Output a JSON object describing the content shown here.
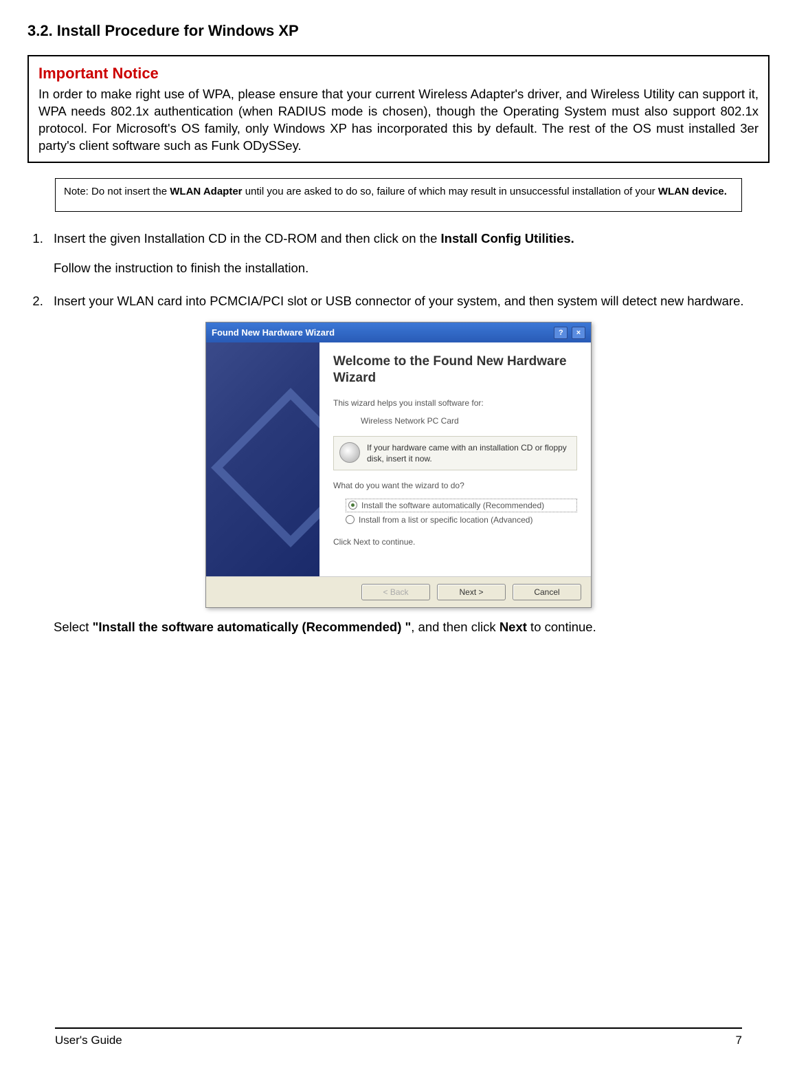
{
  "heading": "3.2. Install Procedure for Windows XP",
  "notice": {
    "title": "Important Notice",
    "body": "In order to make right use of WPA, please ensure that your current Wireless Adapter's driver, and Wireless Utility can support it, WPA needs 802.1x authentication (when RADIUS mode is chosen), though the Operating System must also support 802.1x protocol. For Microsoft's OS family, only Windows XP has incorporated this by default. The rest of the OS must installed 3er party's client software such as Funk ODySSey."
  },
  "note": {
    "pre": "Note: Do not insert the ",
    "bold1": "WLAN Adapter",
    "mid": " until you are asked to do so, failure of which may result in unsuccessful installation of your  ",
    "bold2": "WLAN device."
  },
  "step1": {
    "pre": "Insert the given Installation CD in the CD-ROM and then click on the ",
    "bold": "Install Config Utilities.",
    "sub": "Follow the instruction to finish the installation."
  },
  "step2": "Insert your WLAN card into PCMCIA/PCI slot or USB connector of your system, and then system will detect new hardware.",
  "wizard": {
    "title": "Found New Hardware Wizard",
    "heading": "Welcome to the Found New Hardware Wizard",
    "intro": "This wizard helps you install software for:",
    "device": "Wireless Network PC Card",
    "cd_text": "If your hardware came with an installation CD or floppy disk, insert it now.",
    "question": "What do you want the wizard to do?",
    "opt1": "Install the software automatically (Recommended)",
    "opt2": "Install from a list or specific location (Advanced)",
    "continue_text": "Click Next to continue.",
    "btn_back": "< Back",
    "btn_next": "Next >",
    "btn_cancel": "Cancel"
  },
  "post_select": {
    "pre": "Select ",
    "bold1": "\"Install the software automatically (Recommended) \"",
    "mid": ", and then click ",
    "bold2": "Next",
    "post": " to continue."
  },
  "footer_left": "User's Guide",
  "footer_right": "7"
}
